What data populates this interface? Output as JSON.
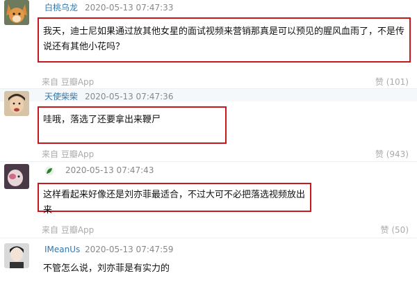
{
  "comments": [
    {
      "username": "白桃乌龙",
      "time": "2020-05-13 07:47:33",
      "text": "我天，迪士尼如果通过放其他女星的面试视频来营销那真是可以预见的腥风血雨了，不是传说还有其他小花吗？",
      "source": "来自  豆瓣App",
      "likes": "赞 (101)"
    },
    {
      "username": "天使柴柴",
      "time": "2020-05-13 07:47:36",
      "text": "哇哦，落选了还要拿出来鞭尸",
      "source": "来自  豆瓣App",
      "likes": "赞 (943)"
    },
    {
      "username": "",
      "time": "2020-05-13 07:47:43",
      "text": "这样看起来好像还是刘亦菲最适合，不过大可不必把落选视频放出来",
      "source": "来自  豆瓣App",
      "likes": "赞 (50)"
    },
    {
      "username": "IMeanUs",
      "time": "2020-05-13 07:47:59",
      "text": "不管怎么说，刘亦菲是有实力的",
      "source": "",
      "likes": ""
    }
  ],
  "colors": {
    "highlight_box": "#c8161d",
    "username": "#3377aa",
    "meta_gray": "#aaaaaa"
  }
}
